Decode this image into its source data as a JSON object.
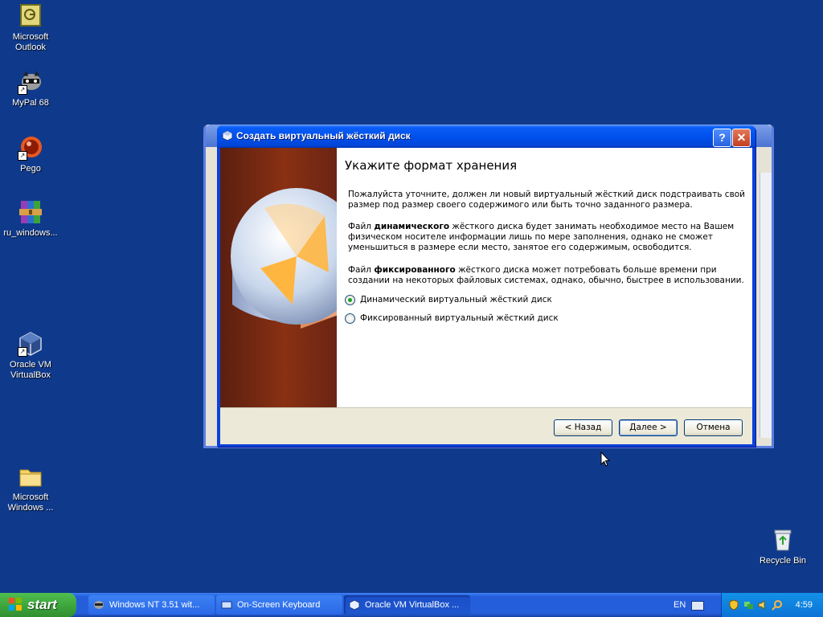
{
  "desktop": {
    "icons": [
      {
        "label": "Microsoft Outlook"
      },
      {
        "label": "MyPal 68"
      },
      {
        "label": "Pego"
      },
      {
        "label": "ru_windows..."
      },
      {
        "label": "Oracle VM VirtualBox"
      },
      {
        "label": "Microsoft Windows ..."
      },
      {
        "label": "Recycle Bin"
      }
    ]
  },
  "dialog": {
    "title": "Создать виртуальный жёсткий диск",
    "heading": "Укажите формат хранения",
    "para1": "Пожалуйста уточните, должен ли новый виртуальный жёсткий диск подстраивать свой размер под размер своего содержимого или быть точно заданного размера.",
    "para2_prefix": "Файл ",
    "para2_bold": "динамического",
    "para2_rest": " жёсткого диска будет занимать необходимое место на Вашем физическом носителе информации лишь по мере заполнения, однако не сможет уменьшиться в размере если место, занятое его содержимым, освободится.",
    "para3_prefix": "Файл ",
    "para3_bold": "фиксированного",
    "para3_rest": " жёсткого диска может потребовать больше времени при создании на некоторых файловых системах, однако, обычно, быстрее в использовании.",
    "options": [
      {
        "label": "Динамический виртуальный жёсткий диск",
        "selected": true
      },
      {
        "label": "Фиксированный виртуальный жёсткий диск",
        "selected": false
      }
    ],
    "buttons": {
      "back": "< Назад",
      "next": "Далее >",
      "cancel": "Отмена"
    }
  },
  "taskbar": {
    "start_label": "start",
    "tasks": [
      {
        "label": "Windows NT 3.51 wit..."
      },
      {
        "label": "On-Screen Keyboard"
      },
      {
        "label": "Oracle VM VirtualBox ..."
      }
    ],
    "language": "EN",
    "clock": "4:59"
  }
}
